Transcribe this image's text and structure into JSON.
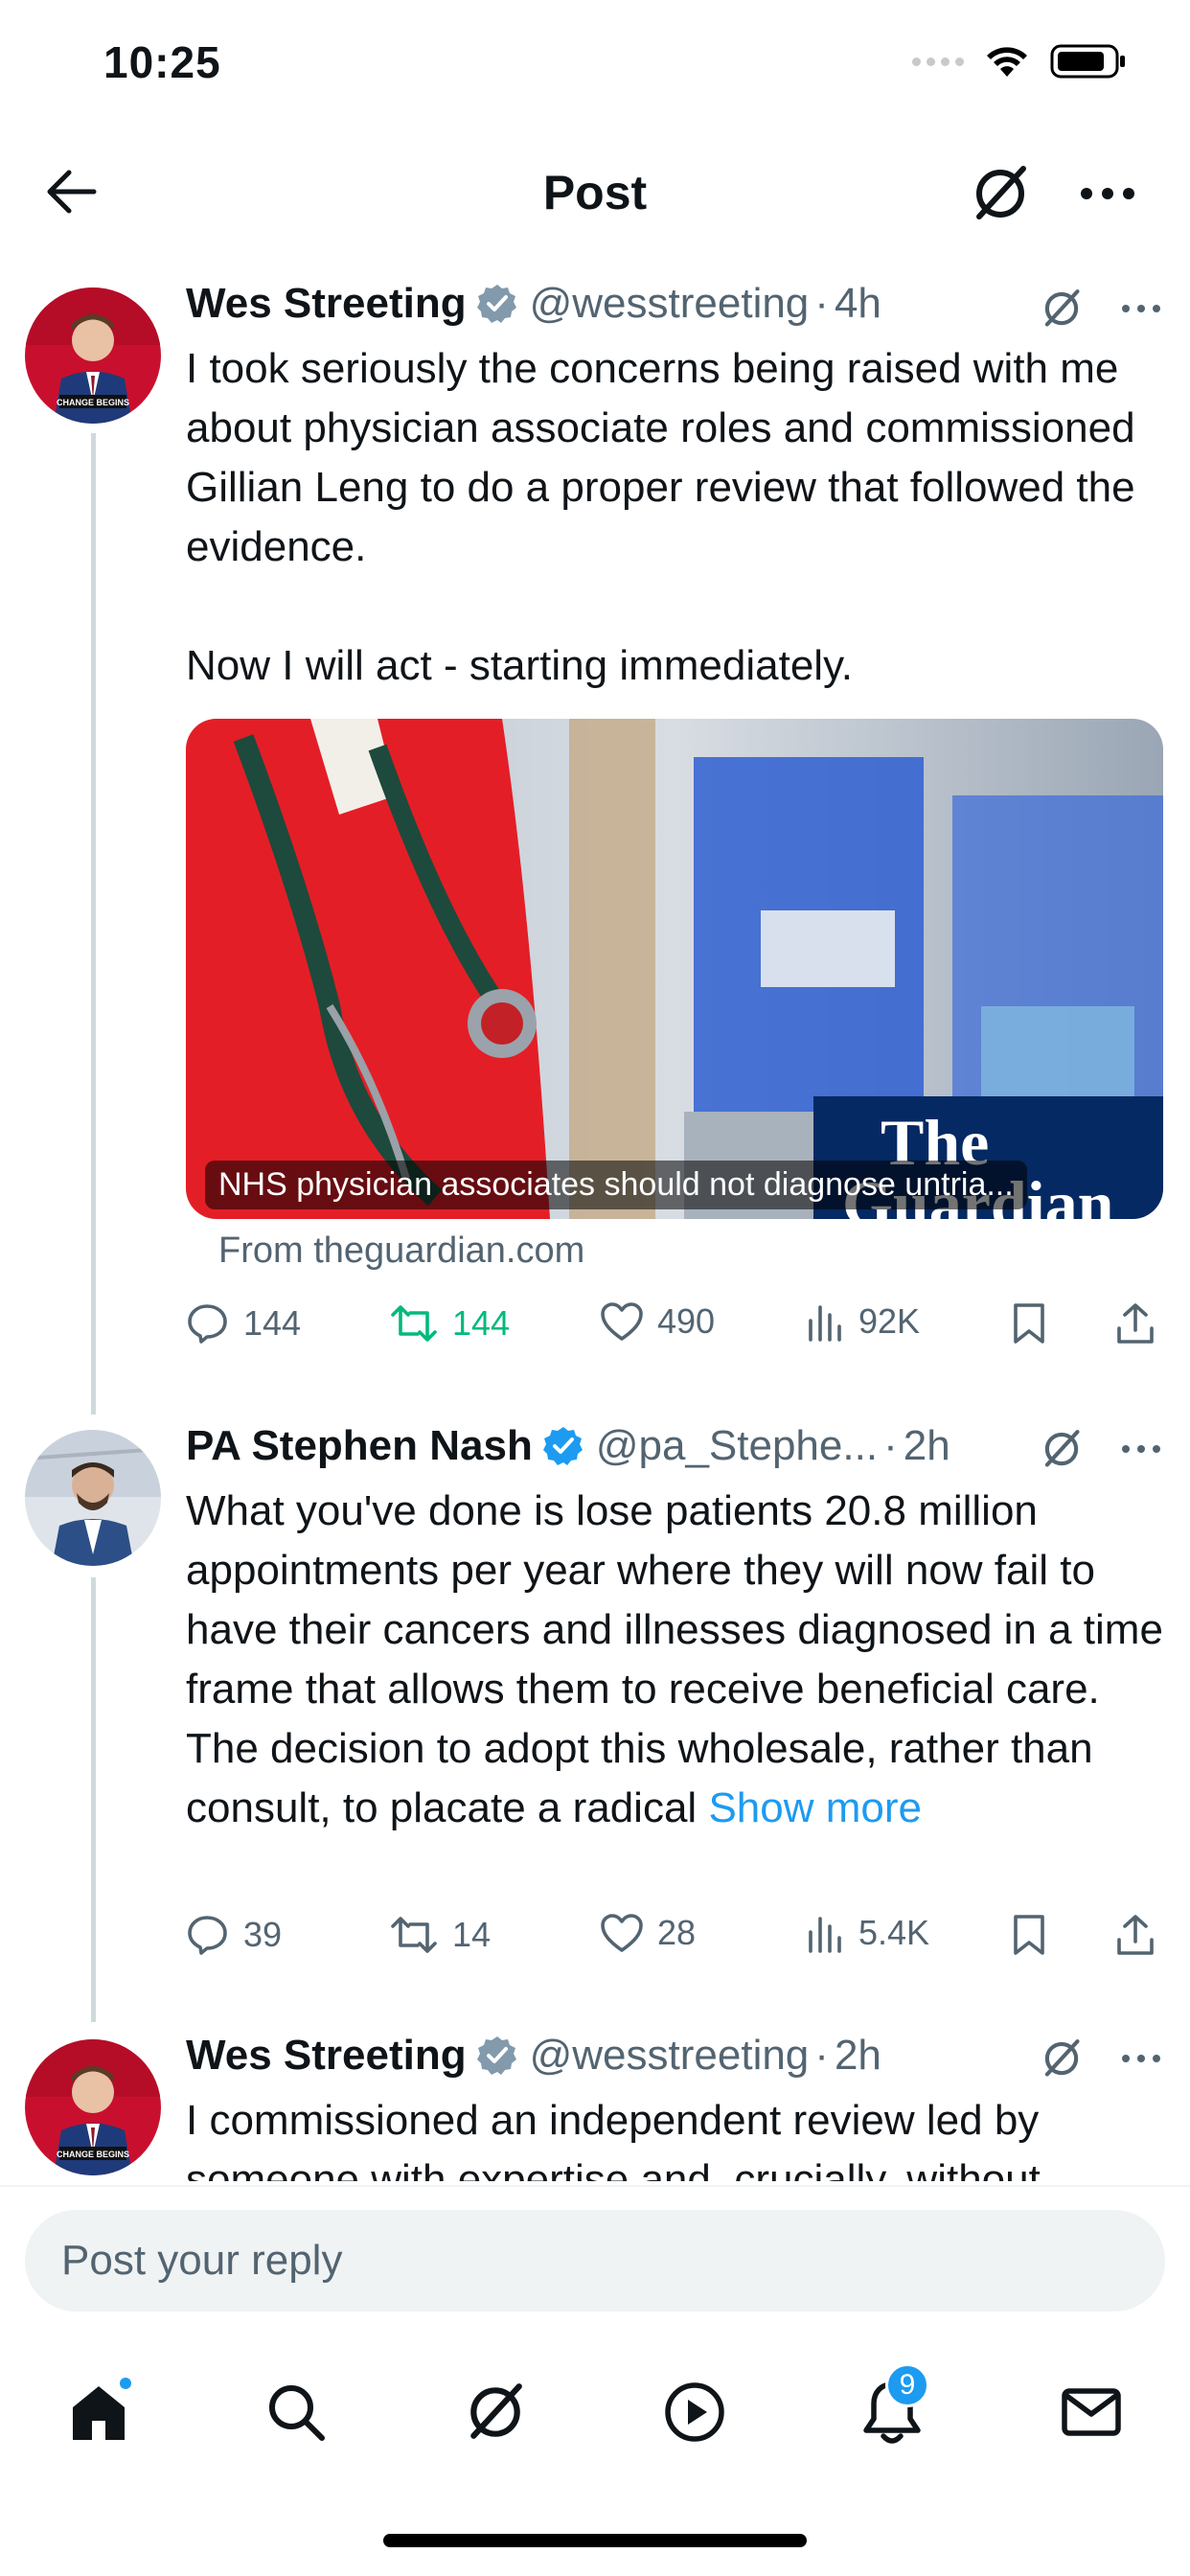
{
  "status_bar": {
    "time": "10:25"
  },
  "header": {
    "title": "Post"
  },
  "posts": [
    {
      "author": "Wes Streeting",
      "handle": "@wesstreeting",
      "sep": "·",
      "time": "4h",
      "text_p1": "I took seriously the concerns being raised with me about physician associate roles and commissioned Gillian Leng to do a proper review that followed the evidence.",
      "text_p2": "Now I will act - starting immediately.",
      "card": {
        "caption": "NHS physician associates should not diagnose untria...",
        "logo_line1": "The",
        "logo_line2": "Guardian",
        "source": "From theguardian.com"
      },
      "stats": {
        "replies": "144",
        "reposts": "144",
        "likes": "490",
        "views": "92K"
      }
    },
    {
      "author": "PA Stephen Nash",
      "handle": "@pa_Stephe...",
      "sep": "·",
      "time": "2h",
      "text": "What you've done is lose patients 20.8 million appointments per year where they will now fail to have their cancers and illnesses diagnosed in a time frame that allows them to receive beneficial care. The decision to adopt this wholesale, rather than consult, to placate a radical",
      "show_more": "Show more",
      "stats": {
        "replies": "39",
        "reposts": "14",
        "likes": "28",
        "views": "5.4K"
      }
    },
    {
      "author": "Wes Streeting",
      "handle": "@wesstreeting",
      "sep": "·",
      "time": "2h",
      "text": "I commissioned an independent review led by someone with expertise and, crucially, without"
    }
  ],
  "reply": {
    "placeholder": "Post your reply"
  },
  "nav": {
    "notifications_count": "9"
  },
  "colors": {
    "accent": "#1d9bf0",
    "repost_green": "#00ba7c",
    "muted": "#536471"
  }
}
